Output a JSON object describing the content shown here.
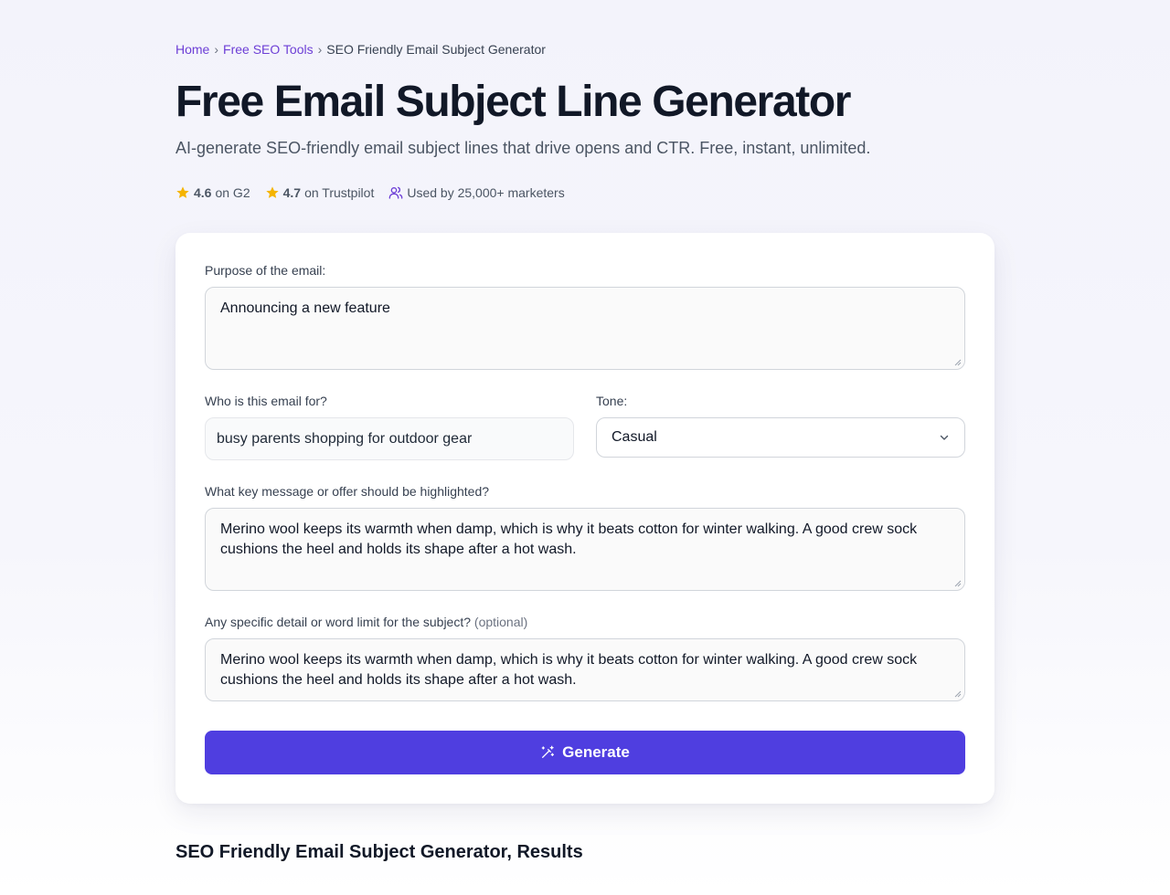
{
  "breadcrumb": {
    "home": "Home",
    "tools": "Free SEO Tools",
    "current": "SEO Friendly Email Subject Generator",
    "separator": "›"
  },
  "header": {
    "title": "Free Email Subject Line Generator",
    "subtitle": "AI-generate SEO-friendly email subject lines that drive opens and CTR. Free, instant, unlimited."
  },
  "ratings": {
    "g2_score": "4.6",
    "g2_label": "on G2",
    "trustpilot_score": "4.7",
    "trustpilot_label": "on Trustpilot",
    "users_label": "Used by 25,000+ marketers",
    "star_color": "#f5b400"
  },
  "form": {
    "purpose_label": "Purpose of the email:",
    "purpose_value": "Announcing a new feature",
    "audience_label": "Who is this email for?",
    "audience_value": "busy parents shopping for outdoor gear",
    "tone_label": "Tone:",
    "tone_value": "Casual",
    "key_message_label": "What key message or offer should be highlighted?",
    "key_message_value": "Merino wool keeps its warmth when damp, which is why it beats cotton for winter walking. A good crew sock cushions the heel and holds its shape after a hot wash.",
    "detail_label": "Any specific detail or word limit for the subject?",
    "detail_optional": "(optional)",
    "detail_value": "Merino wool keeps its warmth when damp, which is why it beats cotton for winter walking. A good crew sock cushions the heel and holds its shape after a hot wash.",
    "generate_label": "Generate",
    "accent_color": "#4f3ee0"
  },
  "results": {
    "title": "SEO Friendly Email Subject Generator, Results"
  }
}
